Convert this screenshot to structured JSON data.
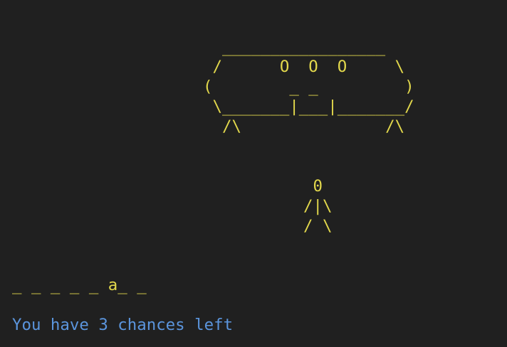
{
  "colors": {
    "background": "#202020",
    "art": "#e2d84c",
    "word": "#e2d84c",
    "status": "#5b95dd"
  },
  "ufo": {
    "lines": [
      "  _________________  ",
      " /      O  O  O     \\",
      "(        _ _         )",
      " \\_______|___|_______/",
      "  /\\               /\\"
    ]
  },
  "person": {
    "lines": [
      " 0",
      "/|\\",
      "/ \\"
    ]
  },
  "word": {
    "display": "_ _ _ _ _ a_ _"
  },
  "status": {
    "message": "You have 3 chances left"
  }
}
